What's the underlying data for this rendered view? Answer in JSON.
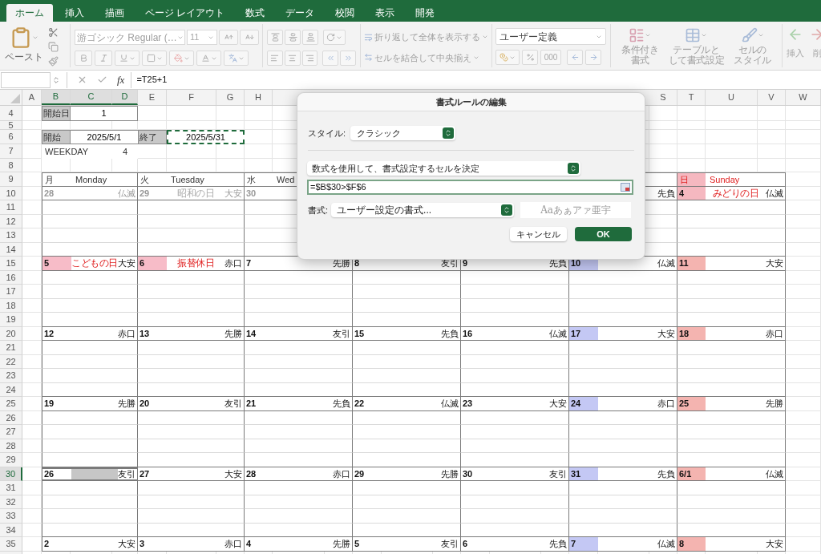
{
  "ribbon_tabs": [
    {
      "label": "ホーム",
      "selected": true
    },
    {
      "label": "挿入",
      "selected": false
    },
    {
      "label": "描画",
      "selected": false
    },
    {
      "label": "ページ レイアウト",
      "selected": false
    },
    {
      "label": "数式",
      "selected": false
    },
    {
      "label": "データ",
      "selected": false
    },
    {
      "label": "校閲",
      "selected": false
    },
    {
      "label": "表示",
      "selected": false
    },
    {
      "label": "開発",
      "selected": false
    }
  ],
  "ribbon": {
    "paste_label": "ペースト",
    "font_name": "游ゴシック Regular (…",
    "font_size": "11",
    "wrap_text": "折り返して全体を表示する",
    "merge_center": "セルを結合して中央揃え",
    "number_format": "ユーザー定義",
    "comma_style": "000",
    "style_buttons": [
      {
        "lines": [
          "条件付き",
          "書式"
        ]
      },
      {
        "lines": [
          "テーブルと",
          "して書式設定"
        ]
      },
      {
        "lines": [
          "セルの",
          "スタイル"
        ]
      }
    ],
    "cell_buttons": [
      {
        "label": "挿入"
      },
      {
        "label": "削"
      }
    ]
  },
  "formula_bar": {
    "fx_label": "fx",
    "formula": "=T25+1"
  },
  "column_headers": [
    {
      "label": "A",
      "selected": false
    },
    {
      "label": "B",
      "selected": true
    },
    {
      "label": "C",
      "selected": true
    },
    {
      "label": "D",
      "selected": true
    },
    {
      "label": "E",
      "selected": false
    },
    {
      "label": "F",
      "selected": false
    },
    {
      "label": "G",
      "selected": false
    },
    {
      "label": "H",
      "selected": false
    },
    {
      "label": "S",
      "selected": false
    },
    {
      "label": "T",
      "selected": false
    },
    {
      "label": "U",
      "selected": false
    },
    {
      "label": "V",
      "selected": false
    },
    {
      "label": "W",
      "selected": false
    }
  ],
  "row_headers": [
    {
      "label": "4",
      "selected": false
    },
    {
      "label": "5",
      "selected": false
    },
    {
      "label": "6",
      "selected": false
    },
    {
      "label": "7",
      "selected": false
    },
    {
      "label": "8",
      "selected": false
    },
    {
      "label": "9",
      "selected": false
    },
    {
      "label": "10",
      "selected": false
    },
    {
      "label": "11",
      "selected": false
    },
    {
      "label": "12",
      "selected": false
    },
    {
      "label": "13",
      "selected": false
    },
    {
      "label": "14",
      "selected": false
    },
    {
      "label": "15",
      "selected": false
    },
    {
      "label": "16",
      "selected": false
    },
    {
      "label": "17",
      "selected": false
    },
    {
      "label": "18",
      "selected": false
    },
    {
      "label": "19",
      "selected": false
    },
    {
      "label": "20",
      "selected": false
    },
    {
      "label": "21",
      "selected": false
    },
    {
      "label": "22",
      "selected": false
    },
    {
      "label": "23",
      "selected": false
    },
    {
      "label": "24",
      "selected": false
    },
    {
      "label": "25",
      "selected": false
    },
    {
      "label": "26",
      "selected": false
    },
    {
      "label": "27",
      "selected": false
    },
    {
      "label": "28",
      "selected": false
    },
    {
      "label": "29",
      "selected": false
    },
    {
      "label": "30",
      "selected": true
    },
    {
      "label": "31",
      "selected": false
    },
    {
      "label": "32",
      "selected": false
    },
    {
      "label": "33",
      "selected": false
    },
    {
      "label": "34",
      "selected": false
    },
    {
      "label": "35",
      "selected": false
    }
  ],
  "info": {
    "start_day_label": "開始日",
    "start_day": "1",
    "start_label": "開始",
    "start_date": "2025/5/1",
    "end_label": "終了",
    "end_date": "2025/5/31",
    "weekday_label": "WEEKDAY",
    "weekday": "4"
  },
  "weekday_headers": [
    {
      "kind": "day",
      "kanji": "月",
      "name": "Monday",
      "sunday": false
    },
    {
      "kind": "day",
      "kanji": "火",
      "name": "Tuesday",
      "sunday": false
    },
    {
      "kind": "day",
      "kanji": "水",
      "name": "Wed",
      "sunday": false
    },
    {
      "kind": "covered"
    },
    {
      "kind": "covered"
    },
    {
      "kind": "covered"
    },
    {
      "kind": "day",
      "kanji": "日",
      "name": "Sunday",
      "sunday": true,
      "color": "#f5b8c0"
    }
  ],
  "weeks": [
    {
      "days": [
        {
          "kind": "day",
          "date": "28",
          "rokuyo": "仏滅",
          "muted": true,
          "selected": false,
          "shaded": false
        },
        {
          "kind": "day",
          "date": "29",
          "holiday": "昭和の日",
          "rokuyo": "大安",
          "muted": true,
          "selected": false,
          "shaded": false
        },
        {
          "kind": "day",
          "date": "30",
          "muted": true,
          "selected": false,
          "shaded": false
        },
        {
          "kind": "covered"
        },
        {
          "kind": "covered"
        },
        {
          "kind": "day",
          "rokuyo": "先負",
          "muted": false,
          "selected": false,
          "shaded": false
        },
        {
          "kind": "day",
          "date": "4",
          "holiday": "みどりの日",
          "rokuyo": "仏滅",
          "color": "#f5b8c0",
          "muted": false,
          "selected": false,
          "shaded": false
        }
      ]
    },
    {
      "days": [
        {
          "kind": "day",
          "date": "5",
          "holiday": "こどもの日",
          "rokuyo": "大安",
          "color": "#f7bcc8",
          "muted": false,
          "selected": false,
          "shaded": false
        },
        {
          "kind": "day",
          "date": "6",
          "holiday": "振替休日",
          "rokuyo": "赤口",
          "color": "#f7bcc8",
          "muted": false,
          "selected": false,
          "shaded": false
        },
        {
          "kind": "day",
          "date": "7",
          "rokuyo": "先勝",
          "muted": false,
          "selected": false,
          "shaded": false
        },
        {
          "kind": "day",
          "date": "8",
          "rokuyo": "友引",
          "muted": false,
          "selected": false,
          "shaded": false
        },
        {
          "kind": "day",
          "date": "9",
          "rokuyo": "先負",
          "muted": false,
          "selected": false,
          "shaded": false
        },
        {
          "kind": "day",
          "date": "10",
          "rokuyo": "仏滅",
          "color": "#c4c8f4",
          "muted": false,
          "selected": false,
          "shaded": false
        },
        {
          "kind": "day",
          "date": "11",
          "rokuyo": "大安",
          "color": "#f4b4b0",
          "muted": false,
          "selected": false,
          "shaded": false
        }
      ]
    },
    {
      "days": [
        {
          "kind": "day",
          "date": "12",
          "rokuyo": "赤口",
          "muted": false,
          "selected": false,
          "shaded": false
        },
        {
          "kind": "day",
          "date": "13",
          "rokuyo": "先勝",
          "muted": false,
          "selected": false,
          "shaded": false
        },
        {
          "kind": "day",
          "date": "14",
          "rokuyo": "友引",
          "muted": false,
          "selected": false,
          "shaded": false
        },
        {
          "kind": "day",
          "date": "15",
          "rokuyo": "先負",
          "muted": false,
          "selected": false,
          "shaded": false
        },
        {
          "kind": "day",
          "date": "16",
          "rokuyo": "仏滅",
          "muted": false,
          "selected": false,
          "shaded": false
        },
        {
          "kind": "day",
          "date": "17",
          "rokuyo": "大安",
          "color": "#c4c8f4",
          "muted": false,
          "selected": false,
          "shaded": false
        },
        {
          "kind": "day",
          "date": "18",
          "rokuyo": "赤口",
          "color": "#f4b4b0",
          "muted": false,
          "selected": false,
          "shaded": false
        }
      ]
    },
    {
      "days": [
        {
          "kind": "day",
          "date": "19",
          "rokuyo": "先勝",
          "muted": false,
          "selected": false,
          "shaded": false
        },
        {
          "kind": "day",
          "date": "20",
          "rokuyo": "友引",
          "muted": false,
          "selected": false,
          "shaded": false
        },
        {
          "kind": "day",
          "date": "21",
          "rokuyo": "先負",
          "muted": false,
          "selected": false,
          "shaded": false
        },
        {
          "kind": "day",
          "date": "22",
          "rokuyo": "仏滅",
          "muted": false,
          "selected": false,
          "shaded": false
        },
        {
          "kind": "day",
          "date": "23",
          "rokuyo": "大安",
          "muted": false,
          "selected": false,
          "shaded": false
        },
        {
          "kind": "day",
          "date": "24",
          "rokuyo": "赤口",
          "color": "#c4c8f4",
          "muted": false,
          "selected": false,
          "shaded": false
        },
        {
          "kind": "day",
          "date": "25",
          "rokuyo": "先勝",
          "color": "#f4b4b0",
          "muted": false,
          "selected": false,
          "shaded": false
        }
      ]
    },
    {
      "days": [
        {
          "kind": "day",
          "date": "26",
          "rokuyo": "友引",
          "muted": false,
          "selected": true,
          "shaded": true
        },
        {
          "kind": "day",
          "date": "27",
          "rokuyo": "大安",
          "muted": false,
          "selected": false,
          "shaded": false
        },
        {
          "kind": "day",
          "date": "28",
          "rokuyo": "赤口",
          "muted": false,
          "selected": false,
          "shaded": false
        },
        {
          "kind": "day",
          "date": "29",
          "rokuyo": "先勝",
          "muted": false,
          "selected": false,
          "shaded": false
        },
        {
          "kind": "day",
          "date": "30",
          "rokuyo": "友引",
          "muted": false,
          "selected": false,
          "shaded": false
        },
        {
          "kind": "day",
          "date": "31",
          "rokuyo": "先負",
          "color": "#c4c8f4",
          "muted": false,
          "selected": false,
          "shaded": false
        },
        {
          "kind": "day",
          "date": "6/1",
          "rokuyo": "仏滅",
          "color": "#f4b4b0",
          "muted": false,
          "selected": false,
          "shaded": false
        }
      ]
    },
    {
      "days": [
        {
          "kind": "day",
          "date": "2",
          "rokuyo": "大安",
          "muted": false,
          "selected": false,
          "shaded": false
        },
        {
          "kind": "day",
          "date": "3",
          "rokuyo": "赤口",
          "muted": false,
          "selected": false,
          "shaded": false
        },
        {
          "kind": "day",
          "date": "4",
          "rokuyo": "先勝",
          "muted": false,
          "selected": false,
          "shaded": false
        },
        {
          "kind": "day",
          "date": "5",
          "rokuyo": "友引",
          "muted": false,
          "selected": false,
          "shaded": false
        },
        {
          "kind": "day",
          "date": "6",
          "rokuyo": "先負",
          "muted": false,
          "selected": false,
          "shaded": false
        },
        {
          "kind": "day",
          "date": "7",
          "rokuyo": "仏滅",
          "color": "#c4c8f4",
          "muted": false,
          "selected": false,
          "shaded": false
        },
        {
          "kind": "day",
          "date": "8",
          "rokuyo": "大安",
          "color": "#f4b4b0",
          "muted": false,
          "selected": false,
          "shaded": false
        }
      ]
    }
  ],
  "dialog": {
    "title": "書式ルールの編集",
    "style_label": "スタイル:",
    "style_value": "クラシック",
    "rule_type": "数式を使用して、書式設定するセルを決定",
    "formula": "=$B$30>$F$6",
    "format_label": "書式:",
    "format_value": "ユーザー設定の書式...",
    "preview": "Aaあぁアァ亜宇",
    "buttons": [
      {
        "label": "キャンセル",
        "kind": "secondary"
      },
      {
        "label": "OK",
        "kind": "primary"
      }
    ]
  }
}
